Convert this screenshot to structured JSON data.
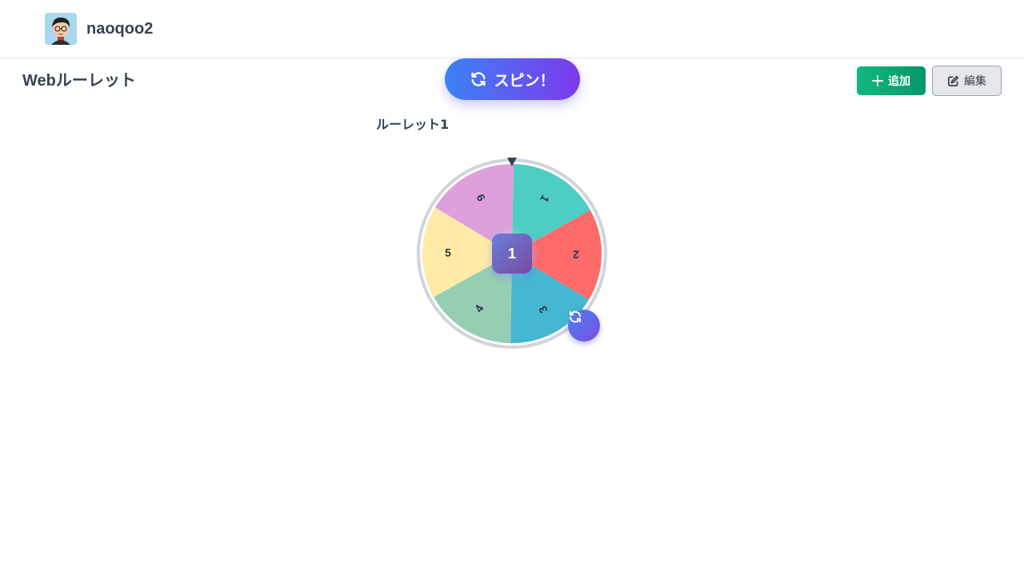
{
  "header": {
    "username": "naoqoo2"
  },
  "page": {
    "title": "Webルーレット"
  },
  "toolbar": {
    "spin_label": "スピン！",
    "add_label": "追加",
    "edit_label": "編集"
  },
  "roulette": {
    "name": "ルーレット1",
    "result": "1",
    "segments": [
      {
        "label": "1",
        "color": "#4ECDC4"
      },
      {
        "label": "2",
        "color": "#FF6B6B"
      },
      {
        "label": "3",
        "color": "#45B7D1"
      },
      {
        "label": "4",
        "color": "#96CEB4"
      },
      {
        "label": "5",
        "color": "#FFEAA7"
      },
      {
        "label": "6",
        "color": "#DDA0DD"
      }
    ]
  },
  "colors": {
    "spin_gradient_start": "#3b82f6",
    "spin_gradient_end": "#7c3aed",
    "add_button": "#10b981",
    "text": "#374151"
  },
  "icons": [
    "refresh-icon",
    "plus-icon",
    "edit-icon",
    "pointer-icon",
    "avatar"
  ]
}
